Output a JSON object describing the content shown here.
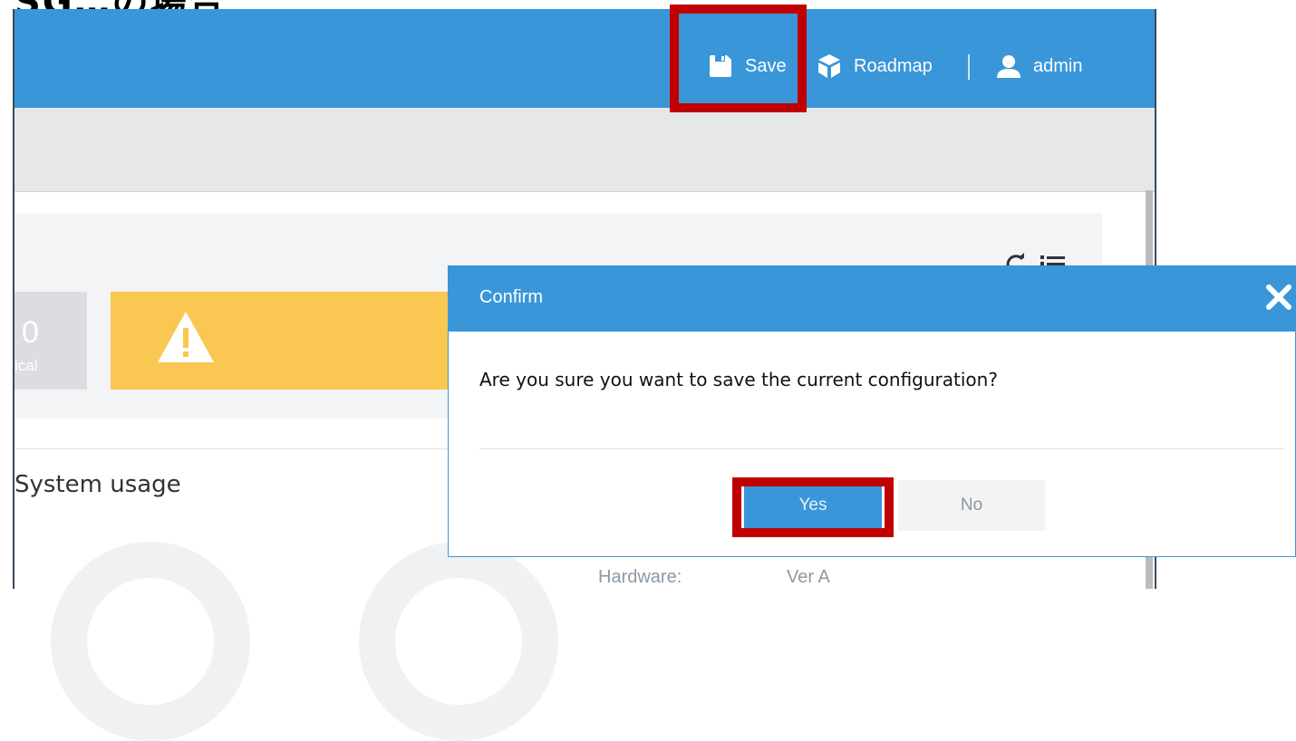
{
  "heading": "SG…の場合",
  "topbar": {
    "save_label": "Save",
    "roadmap_label": "Roadmap",
    "user_label": "admin",
    "save_icon": "floppy-disk-icon",
    "roadmap_icon": "cube-icon",
    "user_icon": "user-icon"
  },
  "panel": {
    "refresh_icon": "refresh-icon",
    "list_icon": "list-icon",
    "critical_count": "0",
    "critical_label": "ical",
    "warning_icon": "warning-icon"
  },
  "section": {
    "title": "System usage",
    "hardware_label": "Hardware:",
    "hardware_value": "Ver A"
  },
  "modal": {
    "title": "Confirm",
    "message": "Are you sure you want to save the current configuration?",
    "yes_label": "Yes",
    "no_label": "No",
    "close_icon": "close-icon"
  },
  "colors": {
    "accent": "#3996d9",
    "warning": "#f9c752",
    "highlight": "#c00000"
  }
}
